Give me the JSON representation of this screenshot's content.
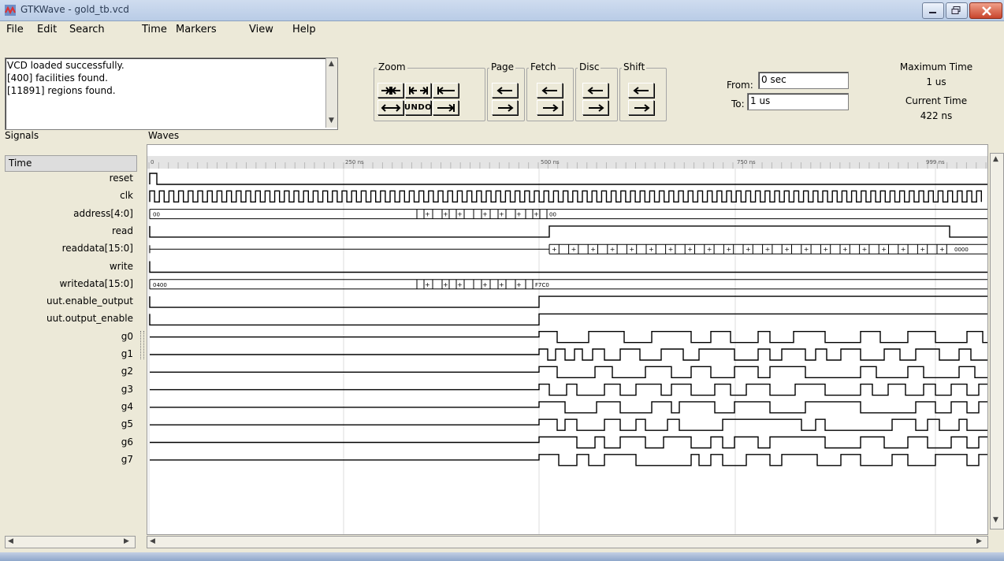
{
  "window": {
    "title": "GTKWave - gold_tb.vcd"
  },
  "menu": [
    "File",
    "Edit",
    "Search",
    "Time",
    "Markers",
    "View",
    "Help"
  ],
  "log": [
    "VCD loaded successfully.",
    "[400] facilities found.",
    "[11891] regions found."
  ],
  "toolbar": {
    "zoom_label": "Zoom",
    "page_label": "Page",
    "fetch_label": "Fetch",
    "disc_label": "Disc",
    "shift_label": "Shift",
    "undo_label": "UNDO"
  },
  "range": {
    "from_label": "From:",
    "from_value": "0 sec",
    "to_label": "To:",
    "to_value": "1 us"
  },
  "status": {
    "max_time_label": "Maximum Time",
    "max_time_value": "1 us",
    "current_time_label": "Current Time",
    "current_time_value": "422 ns"
  },
  "panels": {
    "signals_label": "Signals",
    "waves_label": "Waves",
    "time_header": "Time"
  },
  "signals": [
    "reset",
    "clk",
    "address[4:0]",
    "read",
    "readdata[15:0]",
    "write",
    "writedata[15:0]",
    "uut.enable_output",
    "uut.output_enable",
    "g0",
    "g1",
    "g2",
    "g3",
    "g4",
    "g5",
    "g6",
    "g7"
  ],
  "time_ticks": [
    "0",
    "250 ns",
    "500 ns",
    "750 ns",
    "999 ns"
  ],
  "bus_values": {
    "address_start": "00",
    "address_end": "00",
    "readdata_end": "0000",
    "writedata_start": "0400",
    "writedata_end": "F7C0"
  },
  "colors": {
    "wave": "#000000",
    "grid": "#d8d8d8",
    "bg": "#ece9d8"
  }
}
